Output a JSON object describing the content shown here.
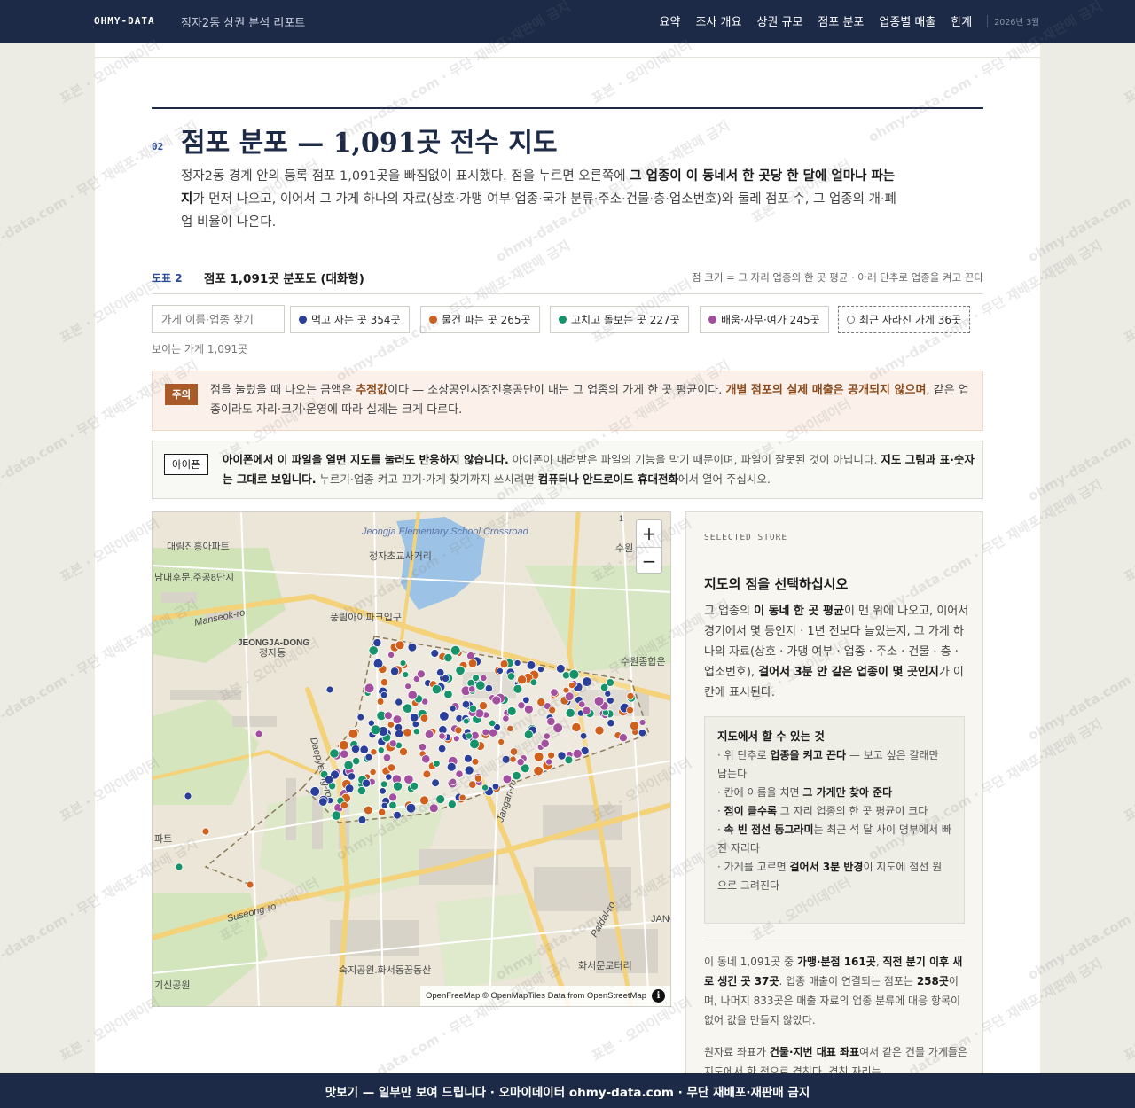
{
  "header": {
    "brand": "OHMY-DATA",
    "subtitle": "정자2동 상권 분석 리포트",
    "nav": [
      "요약",
      "조사 개요",
      "상권 규모",
      "점포 분포",
      "업종별 매출",
      "한계"
    ],
    "date": "2026년 3월"
  },
  "section": {
    "number": "02",
    "title": "점포 분포 — 1,091곳 전수 지도",
    "lead_1": "정자2동 경계 안의 등록 점포 1,091곳을 빠짐없이 표시했다. 점을 누르면 오른쪽에 ",
    "lead_b1": "그 업종이 이 동네서 한 곳당 한 달에 얼마나 파는지",
    "lead_2": "가 먼저 나오고, 이어서 그 가게 하나의 자료(상호·가맹 여부·업종·국가 분류·주소·건물·층·업소번호)와 둘레 점포 수, 그 업종의 개·폐업 비율이 나온다."
  },
  "figure": {
    "tag": "도표 2",
    "title": "점포 1,091곳 분포도 (대화형)",
    "note": "점 크기 = 그 자리 업종의 한 곳 평균 · 아래 단추로 업종을 켜고 끈다"
  },
  "filters": {
    "search_placeholder": "가게 이름·업종 찾기",
    "chips": [
      {
        "label": "먹고 자는 곳 354곳",
        "color": "#2a3f9a"
      },
      {
        "label": "물건 파는 곳 265곳",
        "color": "#d0601c"
      },
      {
        "label": "고치고 돌보는 곳 227곳",
        "color": "#16936a"
      },
      {
        "label": "배움·사무·여가 245곳",
        "color": "#a34fa0"
      }
    ],
    "closed_chip": "최근 사라진 가게 36곳",
    "visible_count": "보이는 가게 1,091곳"
  },
  "warning": {
    "badge": "주의",
    "t1": "점을 눌렀을 때 나오는 금액은 ",
    "b1": "추정값",
    "t2": "이다 — 소상공인시장진흥공단이 내는 그 업종의 가게 한 곳 평균이다. ",
    "b2": "개별 점포의 실제 매출은 공개되지 않으며",
    "t3": ", 같은 업종이라도 자리·크기·운영에 따라 실제는 크게 다르다."
  },
  "ios": {
    "badge": "아이폰",
    "b1": "아이폰에서 이 파일을 열면 지도를 눌러도 반응하지 않습니다.",
    "t1": " 아이폰이 내려받은 파일의 기능을 막기 때문이며, 파일이 잘못된 것이 아닙니다. ",
    "b2": "지도 그림과 표·숫자는 그대로 보입니다.",
    "t2": " 누르기·업종 켜고 끄기·가게 찾기까지 쓰시려면 ",
    "b3": "컴퓨터나 안드로이드 휴대전화",
    "t3": "에서 열어 주십시오."
  },
  "map": {
    "zoom_in": "+",
    "zoom_out": "−",
    "attribution": "OpenFreeMap © OpenMapTiles Data from OpenStreetMap",
    "labels": [
      "Jeongja Elementary School Crossroad",
      "정자초교사거리",
      "대림진흥아파트",
      "남대후문.주공8단지",
      "Manseok-ro",
      "풍림아이파크입구",
      "JEONGJA-DONG",
      "정자동",
      "수원종합운",
      "Daepyeong-ro",
      "Jangan-ro",
      "Suseong-ro",
      "Paldal-ro",
      "숙지공원.화서동꿈동산",
      "화서문로터리",
      "기신공원",
      "파트",
      "JANG",
      "수원",
      "1"
    ],
    "store_dots": {
      "food_count": 354,
      "retail_count": 265,
      "service_count": 227,
      "office_count": 245,
      "closed_count": 36
    }
  },
  "side": {
    "kicker": "SELECTED STORE",
    "title": "지도의 점을 선택하십시오",
    "t1": "그 업종의 ",
    "b1": "이 동네 한 곳 평균",
    "t2": "이 맨 위에 나오고, 이어서 경기에서 몇 등인지 · 1년 전보다 늘었는지, 그 가게 하나의 자료(상호 · 가맹 여부 · 업종 · 주소 · 건물 · 층 · 업소번호), ",
    "b2": "걸어서 3분 안 같은 업종이 몇 곳인지",
    "t3": "가 이 칸에 표시된다.",
    "howto_title": "지도에서 할 수 있는 것",
    "howto": [
      {
        "pre": "· 위 단추로 ",
        "b": "업종을 켜고 끈다",
        "post": " — 보고 싶은 갈래만 남는다"
      },
      {
        "pre": "· 칸에 이름을 치면 ",
        "b": "그 가게만 찾아 준다",
        "post": ""
      },
      {
        "pre": "· ",
        "b": "점이 클수록",
        "post": " 그 자리 업종의 한 곳 평균이 크다"
      },
      {
        "pre": "· ",
        "b": "속 빈 점선 동그라미",
        "post": "는 최근 석 달 사이 명부에서 빠진 자리다"
      },
      {
        "pre": "· 가게를 고르면 ",
        "b": "걸어서 3분 반경",
        "post": "이 지도에 점선 원으로 그려진다"
      }
    ],
    "s1": "이 동네 1,091곳 중 ",
    "sb1": "가맹·분점 161곳",
    "s2": ", ",
    "sb2": "직전 분기 이후 새로 생긴 곳 37곳",
    "s3": ". 업종 매출이 연결되는 점포는 ",
    "sb3": "258곳",
    "s4": "이며, 나머지 833곳은 매출 자료의 업종 분류에 대응 항목이 없어 값을 만들지 않았다.",
    "m1": "원자료 좌표가 ",
    "mb1": "건물·지번 대표 좌표",
    "m2": "여서 같은 건물 가게들은 지도에서 한 점으로 겹친다. 겹친 자리는"
  },
  "footer": "맛보기 — 일부만 보여 드립니다 · 오마이데이터 ohmy-data.com · 무단 재배포·재판매 금지",
  "watermark": [
    "표본 · 오마이데이터",
    "ohmy-data.com · 무단 재배포·재판매 금지"
  ]
}
